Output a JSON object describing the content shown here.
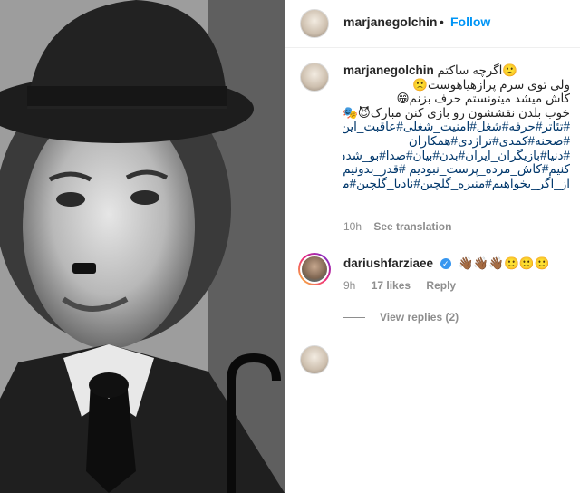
{
  "header": {
    "username": "marjanegolchin",
    "separator": "•",
    "follow_label": "Follow"
  },
  "caption": {
    "username": "marjanegolchin",
    "lines": [
      "اگرچه ساکتم🙁",
      "ولی توی سرم پرازهیاهوست🙁",
      "کاش میشد میتونستم حرف بزنم😁",
      "خوب بلدن نقششون رو بازی کنن مبارک😈🎭😈",
      "#تئاتر#حرفه#شغل#امنیت_شغلی#عاقبت_این_کار#سینما",
      "#صحنه#کمدی#تراژدی#همکاران",
      "#دنیا#بازیگران_ایران#بدن#بیان#صدا#بو_شدن #شروع_",
      "کنیم#کاش_مرده_پرست_نبودیم #قدر_بدونیم#پیش_",
      "از_اگر_بخواهیم#منیره_گلچین#نادیا_گلچین#مرجانه_گلچین"
    ],
    "time": "10h",
    "see_translation": "See translation"
  },
  "comment": {
    "username": "dariushfarziaee",
    "verified_mark": "✓",
    "text": "👋🏾👋🏾👋🏾🙂🙂🙂",
    "time": "9h",
    "likes": "17 likes",
    "reply_label": "Reply",
    "view_replies": "View replies (2)"
  },
  "colors": {
    "link_blue": "#0095f6",
    "hashtag": "#00376b",
    "muted": "#8e8e8e"
  }
}
